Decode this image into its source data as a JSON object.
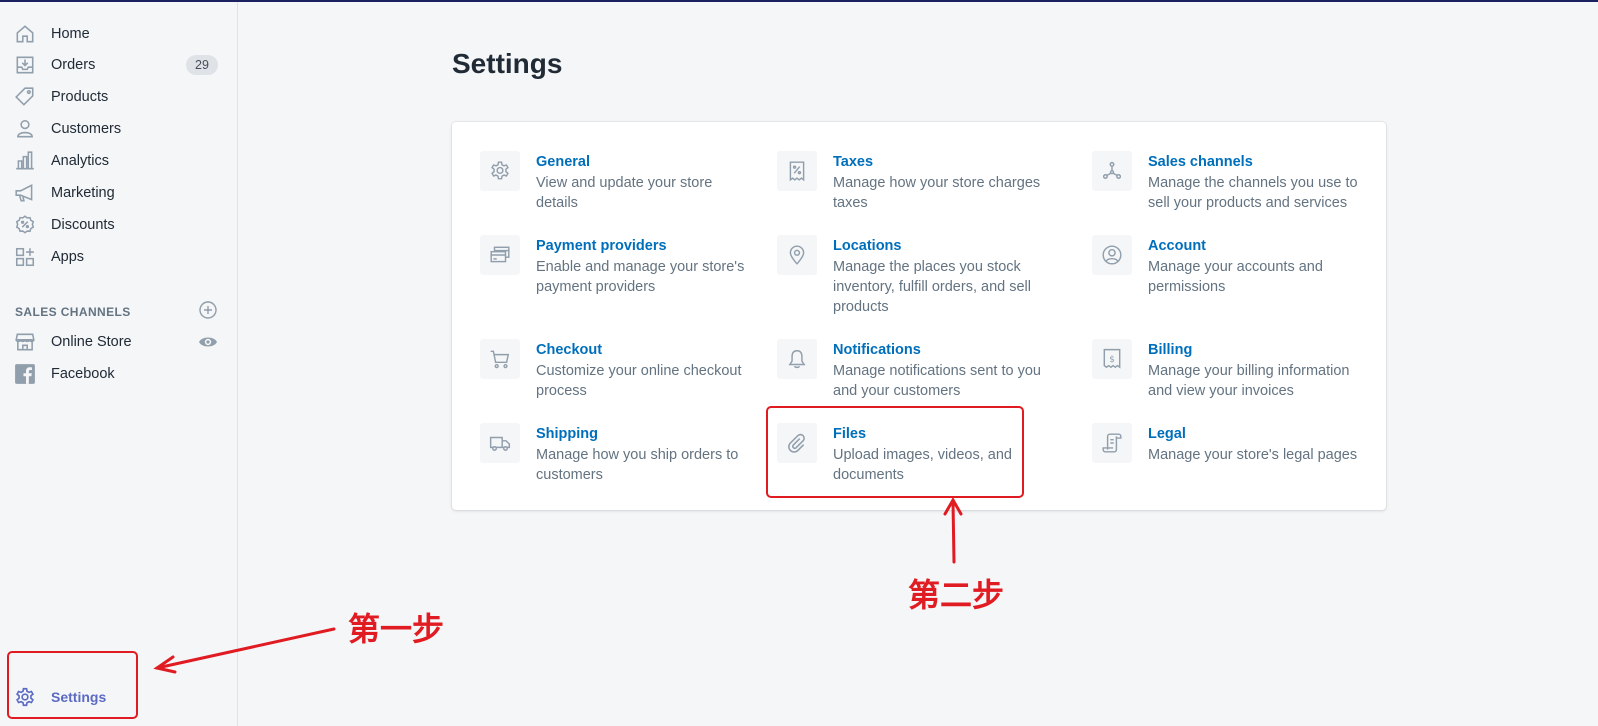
{
  "sidebar": {
    "items": [
      {
        "label": "Home",
        "icon": "home-icon"
      },
      {
        "label": "Orders",
        "icon": "orders-icon",
        "badge": "29"
      },
      {
        "label": "Products",
        "icon": "tag-icon"
      },
      {
        "label": "Customers",
        "icon": "person-icon"
      },
      {
        "label": "Analytics",
        "icon": "bar-chart-icon"
      },
      {
        "label": "Marketing",
        "icon": "megaphone-icon"
      },
      {
        "label": "Discounts",
        "icon": "discount-icon"
      },
      {
        "label": "Apps",
        "icon": "apps-icon"
      }
    ],
    "sales_channels_heading": "SALES CHANNELS",
    "channels": [
      {
        "label": "Online Store",
        "icon": "store-icon"
      },
      {
        "label": "Facebook",
        "icon": "facebook-icon"
      }
    ],
    "settings_label": "Settings"
  },
  "page_title": "Settings",
  "settings": [
    {
      "title": "General",
      "desc": "View and update your store details",
      "icon": "gear-icon"
    },
    {
      "title": "Taxes",
      "desc": "Manage how your store charges taxes",
      "icon": "receipt-percent-icon"
    },
    {
      "title": "Sales channels",
      "desc": "Manage the channels you use to sell your products and services",
      "icon": "channels-icon"
    },
    {
      "title": "Payment providers",
      "desc": "Enable and manage your store's payment providers",
      "icon": "credit-cards-icon"
    },
    {
      "title": "Locations",
      "desc": "Manage the places you stock inventory, fulfill orders, and sell products",
      "icon": "location-pin-icon"
    },
    {
      "title": "Account",
      "desc": "Manage your accounts and permissions",
      "icon": "account-icon"
    },
    {
      "title": "Checkout",
      "desc": "Customize your online checkout process",
      "icon": "cart-icon"
    },
    {
      "title": "Notifications",
      "desc": "Manage notifications sent to you and your customers",
      "icon": "bell-icon"
    },
    {
      "title": "Billing",
      "desc": "Manage your billing information and view your invoices",
      "icon": "billing-icon"
    },
    {
      "title": "Shipping",
      "desc": "Manage how you ship orders to customers",
      "icon": "truck-icon"
    },
    {
      "title": "Files",
      "desc": "Upload images, videos, and documents",
      "icon": "paperclip-icon"
    },
    {
      "title": "Legal",
      "desc": "Manage your store's legal pages",
      "icon": "scroll-icon"
    }
  ],
  "annotations": {
    "step1": "第一步",
    "step2": "第二步",
    "color": "#e01b22"
  }
}
